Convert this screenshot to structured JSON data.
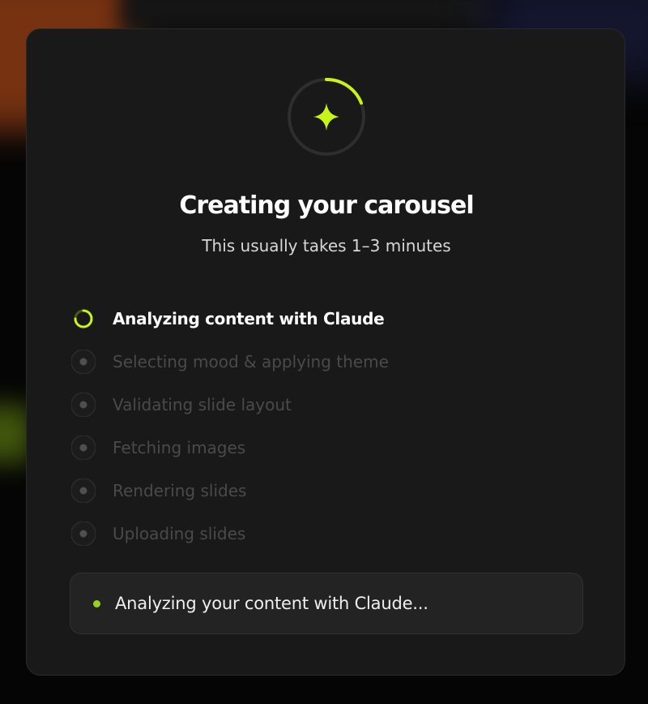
{
  "modal": {
    "title": "Creating your carousel",
    "subtitle": "This usually takes 1–3 minutes",
    "spinner_icon": "sparkle-icon"
  },
  "steps": [
    {
      "label": "Analyzing content with Claude",
      "state": "active"
    },
    {
      "label": "Selecting mood & applying theme",
      "state": "pending"
    },
    {
      "label": "Validating slide layout",
      "state": "pending"
    },
    {
      "label": "Fetching images",
      "state": "pending"
    },
    {
      "label": "Rendering slides",
      "state": "pending"
    },
    {
      "label": "Uploading slides",
      "state": "pending"
    }
  ],
  "status": {
    "text": "Analyzing your content with Claude..."
  },
  "colors": {
    "accent": "#c8f41a",
    "panel": "#191919",
    "pending": "#4a4a4a"
  }
}
